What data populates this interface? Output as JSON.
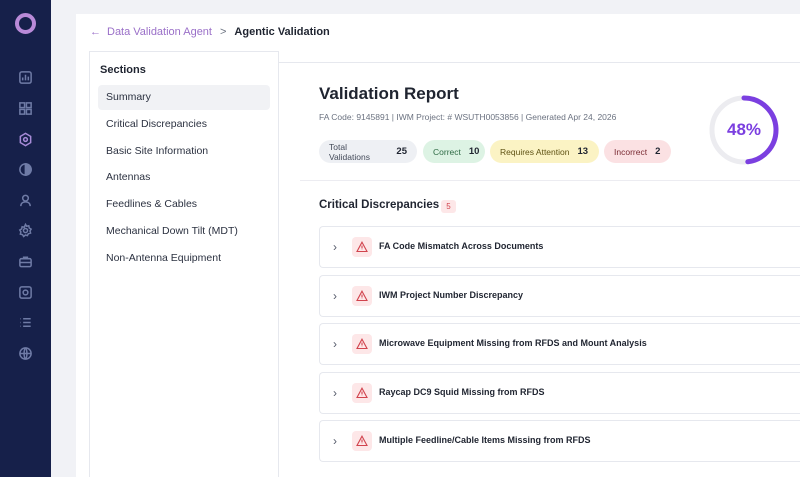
{
  "nav": {
    "icons": [
      "chart-icon",
      "grid-icon",
      "hexagon-icon",
      "contrast-icon",
      "user-icon",
      "settings-icon",
      "briefcase-icon",
      "camera-icon",
      "list-icon",
      "globe-icon"
    ]
  },
  "breadcrumb": {
    "parent": "Data Validation Agent",
    "separator": ">",
    "current": "Agentic Validation"
  },
  "sections": {
    "heading": "Sections",
    "items": [
      {
        "label": "Summary"
      },
      {
        "label": "Critical Discrepancies"
      },
      {
        "label": "Basic Site Information"
      },
      {
        "label": "Antennas"
      },
      {
        "label": "Feedlines & Cables"
      },
      {
        "label": "Mechanical Down Tilt (MDT)"
      },
      {
        "label": "Non-Antenna Equipment"
      }
    ]
  },
  "report": {
    "title": "Validation Report",
    "meta": "FA Code: 9145891 | IWM Project: # WSUTH0053856 | Generated Apr 24, 2026",
    "stats": {
      "total_label": "Total Validations",
      "total": "25",
      "correct_label": "Correct",
      "correct": "10",
      "attention_label": "Requires Attention",
      "attention": "13",
      "incorrect_label": "Incorrect",
      "incorrect": "2"
    },
    "score": "48%",
    "score_fraction": 0.48,
    "accent_color": "#7b3fe0"
  },
  "critical": {
    "title": "Critical Discrepancies",
    "count": "5",
    "items": [
      {
        "label": "FA Code Mismatch Across Documents"
      },
      {
        "label": "IWM Project Number Discrepancy"
      },
      {
        "label": "Microwave Equipment Missing from RFDS and Mount Analysis"
      },
      {
        "label": "Raycap DC9 Squid Missing from RFDS"
      },
      {
        "label": "Multiple Feedline/Cable Items Missing from RFDS"
      }
    ]
  }
}
